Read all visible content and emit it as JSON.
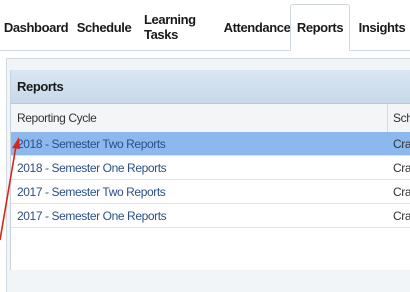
{
  "tabs": [
    {
      "label": "Dashboard",
      "active": false
    },
    {
      "label": "Schedule",
      "active": false
    },
    {
      "label": "Learning Tasks",
      "active": false
    },
    {
      "label": "Attendance",
      "active": false
    },
    {
      "label": "Reports",
      "active": true
    },
    {
      "label": "Insights",
      "active": false
    }
  ],
  "panel": {
    "title": "Reports",
    "columns": [
      "Reporting Cycle",
      "Scho"
    ],
    "rows": [
      {
        "cycle": "2018 - Semester Two Reports",
        "school": "Cran",
        "selected": true
      },
      {
        "cycle": "2018 - Semester One Reports",
        "school": "Cran",
        "selected": false
      },
      {
        "cycle": "2017 - Semester Two Reports",
        "school": "Cran",
        "selected": false
      },
      {
        "cycle": "2017 - Semester One Reports",
        "school": "Cran",
        "selected": false
      }
    ]
  },
  "colors": {
    "selected_row": "#8cb8ee",
    "link_text": "#2a4f86",
    "header_bg": "#d9e6f2",
    "annotation_arrow": "#d9261c"
  }
}
